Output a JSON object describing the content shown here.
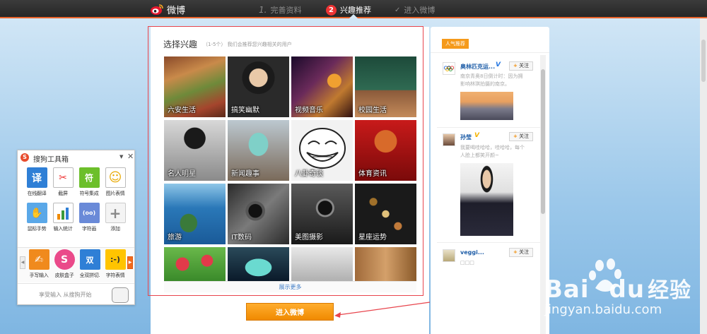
{
  "header": {
    "logo_text": "微博",
    "steps": [
      {
        "num": "1.",
        "label": "完善资料"
      },
      {
        "num": "2",
        "label": "兴趣推荐"
      },
      {
        "num": "✓",
        "label": "进入微博"
      }
    ]
  },
  "interests": {
    "title": "选择兴趣",
    "subtitle": "（1-5个） 我们会推荐您兴趣相关的用户",
    "tiles": [
      {
        "label": "六安生活"
      },
      {
        "label": "搞笑幽默"
      },
      {
        "label": "视频音乐"
      },
      {
        "label": "校园生活"
      },
      {
        "label": "名人明星"
      },
      {
        "label": "新闻趣事"
      },
      {
        "label": "八卦奇谈"
      },
      {
        "label": "体育资讯"
      },
      {
        "label": "旅游"
      },
      {
        "label": "IT数码"
      },
      {
        "label": "美图摄影"
      },
      {
        "label": "星座运势"
      }
    ],
    "more_label": "展示更多",
    "enter_button": "进入微博"
  },
  "sidebar": {
    "tag": "人气推荐",
    "follow_label": "关注",
    "cards": [
      {
        "name": "奥林匹克运...",
        "verified": "V",
        "desc_line1": "南京青奥8日倒计时：因为拥",
        "desc_line2": "影响林琪拍摄的南京。"
      },
      {
        "name": "孙莹",
        "verified": "V",
        "desc_line1": "我要喝哇哈哈，哇哈哈，每个",
        "desc_line2": "人脸上都笑开颜~"
      },
      {
        "name": "veggi...",
        "verified": "",
        "desc_line1": "□□□",
        "desc_line2": ""
      }
    ]
  },
  "toolbox": {
    "title": "搜狗工具箱",
    "items": [
      {
        "label": "在线翻译",
        "icon": "译"
      },
      {
        "label": "截屏",
        "icon": "✂"
      },
      {
        "label": "符号集成",
        "icon": "符"
      },
      {
        "label": "图片表情",
        "icon": "☺"
      },
      {
        "label": "鼠标手势",
        "icon": "✋"
      },
      {
        "label": "输入统计",
        "icon": "▮"
      },
      {
        "label": "字符画",
        "icon": "(oo)"
      },
      {
        "label": "添加",
        "icon": "+"
      }
    ],
    "row2": [
      {
        "label": "手写输入",
        "icon": "✍"
      },
      {
        "label": "皮肤盒子",
        "icon": "S"
      },
      {
        "label": "全双拼切.",
        "icon": "双"
      },
      {
        "label": "字符表情",
        "icon": ":-)"
      }
    ],
    "footer": "享受输入 从搜狗开始"
  },
  "watermark": {
    "brand": "Bai",
    "brand2": "du",
    "cn": "经验",
    "url": "jingyan.baidu.com"
  }
}
